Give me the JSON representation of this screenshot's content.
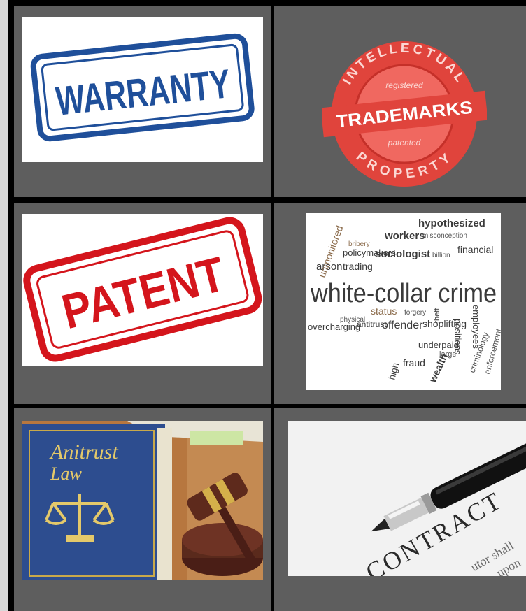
{
  "tiles": {
    "warranty": {
      "stamp_text": "WARRANTY",
      "color": "#1f4f9a"
    },
    "trademarks": {
      "stamp_text": "TRADEMARKS",
      "ring_top": "INTELLECTUAL",
      "ring_bottom": "PROPERTY",
      "inner_top": "registered",
      "inner_bottom": "patented",
      "color": "#e0443c"
    },
    "patent": {
      "stamp_text": "PATENT",
      "color": "#d4151c"
    },
    "wordcloud": {
      "main": "white-collar crime",
      "words": [
        "hypothesized",
        "workers",
        "misconception",
        "bribery",
        "policymakers",
        "sociologist",
        "financial",
        "billion",
        "arson",
        "trading",
        "unmonitored",
        "status",
        "overcharging",
        "offender",
        "shoplifting",
        "positions",
        "employees",
        "criminology",
        "enforcement",
        "fraud",
        "underpaid",
        "forgery",
        "theft",
        "physical",
        "antitrust",
        "large",
        "high",
        "wealth"
      ]
    },
    "antitrust": {
      "title_line1": "Anitrust",
      "title_line2": "Law"
    },
    "contract": {
      "heading": "CONTRACT",
      "fragment1": "utor shall",
      "fragment2": "upon"
    }
  }
}
